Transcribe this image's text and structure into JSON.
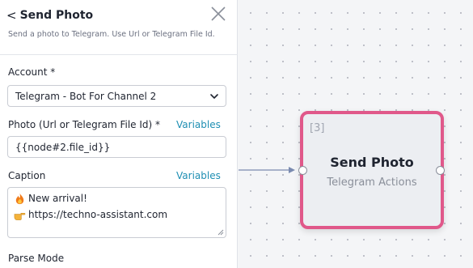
{
  "panel": {
    "back_chevron": "<",
    "title": "Send Photo",
    "subtitle": "Send a photo to Telegram. Use Url or Telegram File Id.",
    "close_icon": "close-icon"
  },
  "form": {
    "account": {
      "label": "Account *",
      "value": "Telegram - Bot For Channel 2"
    },
    "photo": {
      "label": "Photo (Url or Telegram File Id) *",
      "variables_link": "Variables",
      "value": "{{node#2.file_id}}"
    },
    "caption": {
      "label": "Caption",
      "variables_link": "Variables",
      "lines": [
        {
          "icon": "fire-emoji",
          "text": "New arrival!"
        },
        {
          "icon": "pointing-hand-emoji",
          "text": "https://techno-assistant.com"
        }
      ]
    },
    "parse_mode": {
      "label": "Parse Mode"
    }
  },
  "node": {
    "index": "[3]",
    "title": "Send Photo",
    "subtitle": "Telegram Actions",
    "border_color": "#e0588a"
  },
  "colors": {
    "accent_link": "#1f8fb3",
    "node_border": "#e0588a",
    "connector": "#7a8bb0"
  }
}
